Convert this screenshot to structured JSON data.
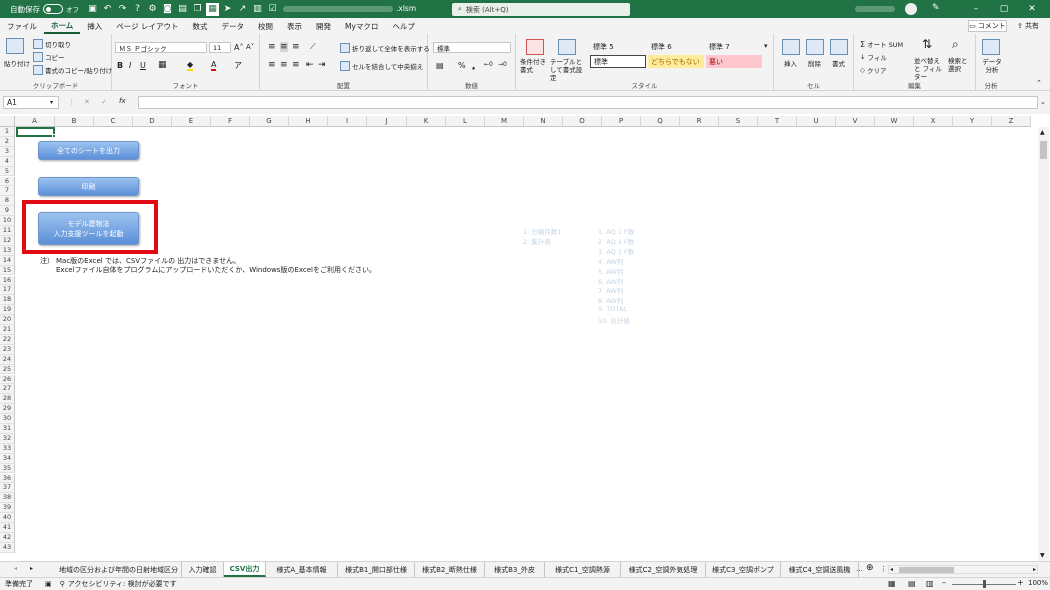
{
  "title_bar": {
    "autosave_label": "自動保存",
    "autosave_state": "オフ",
    "file_name": ".xlsm",
    "search_placeholder": "検索 (Alt+Q)"
  },
  "menu": [
    "ファイル",
    "ホーム",
    "挿入",
    "ページ レイアウト",
    "数式",
    "データ",
    "校閲",
    "表示",
    "開発",
    "Myマクロ",
    "ヘルプ"
  ],
  "menu_active": "ホーム",
  "comment_button": "コメント",
  "share_button": "共有",
  "ribbon": {
    "clipboard": {
      "paste": "貼り付け",
      "cut": "切り取り",
      "copy": "コピー",
      "format_painter": "書式のコピー/貼り付け",
      "label": "クリップボード"
    },
    "font": {
      "name": "ＭＳ Ｐゴシック",
      "size": "11",
      "label": "フォント"
    },
    "alignment": {
      "wrap": "折り返して全体を表示する",
      "merge": "セルを結合して中央揃え",
      "label": "配置"
    },
    "number": {
      "format": "標準",
      "label": "数値"
    },
    "styles": {
      "conditional": "条件付き書式",
      "table": "テーブルとして書式設定",
      "cells": [
        "標準 5",
        "標準 6",
        "標準 7",
        "標準",
        "どちらでもない",
        "悪い"
      ],
      "label": "スタイル"
    },
    "cells_group": {
      "insert": "挿入",
      "delete": "削除",
      "format": "書式",
      "label": "セル"
    },
    "editing": {
      "autosum": "オート SUM",
      "fill": "フィル",
      "clear": "クリア",
      "sort": "並べ替えと フィルター",
      "find": "検索と 選択",
      "label": "編集"
    },
    "analysis": {
      "data": "データ 分析",
      "label": "分析"
    }
  },
  "formula_bar": {
    "name_box": "A1"
  },
  "columns": [
    "A",
    "B",
    "C",
    "D",
    "E",
    "F",
    "G",
    "H",
    "I",
    "J",
    "K",
    "L",
    "M",
    "N",
    "O",
    "P",
    "Q",
    "R",
    "S",
    "T",
    "U",
    "V",
    "W",
    "X",
    "Y",
    "Z"
  ],
  "buttons": {
    "export_all": "全てのシートを出力",
    "print": "印刷",
    "model_tool_line1": "モデル建物法",
    "model_tool_line2": "入力支援ツールを起動"
  },
  "note": {
    "prefix": "注）",
    "line1": "Mac版のExcel では、CSVファイルの 出力はできません。",
    "line2": "Excelファイル自体をプログラムにアップロードいただくか、Windows版のExcelをご利用ください。"
  },
  "faint_text": {
    "left": [
      "1. 分類件数1",
      "2. 集計表"
    ],
    "right": [
      "1. AQ 1 F数",
      "2. AQ 1 F数",
      "3. AQ 1 F数",
      "4. AW列",
      "5. AW列",
      "6. AW列",
      "7. AW列",
      "8. AW列",
      "9. TOTAL",
      "10. 合計値"
    ]
  },
  "sheet_tabs": [
    "地域の区分および年間の日射地域区分",
    "入力確認",
    "CSV出力",
    "様式A_基本情報",
    "様式B1_開口部仕様",
    "様式B2_断熱仕様",
    "様式B3_外皮",
    "様式C1_空調熱源",
    "様式C2_空調外気処理",
    "様式C3_空調ポンプ",
    "様式C4_空調送風機"
  ],
  "active_tab": "CSV出力",
  "status": {
    "ready": "準備完了",
    "accessibility": "アクセシビリティ: 検討が必要です",
    "zoom": "100%"
  }
}
